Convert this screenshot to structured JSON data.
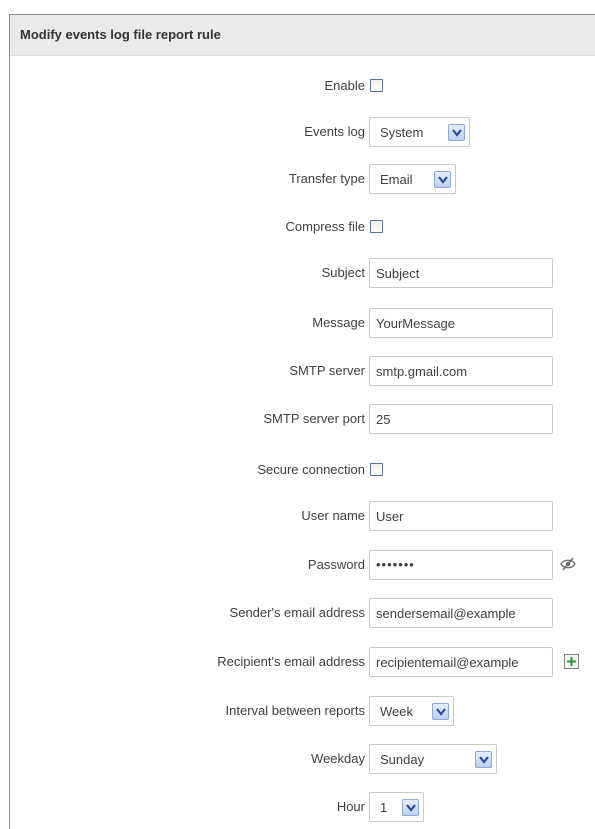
{
  "panel": {
    "title": "Modify events log file report rule"
  },
  "form": {
    "enable": {
      "label": "Enable",
      "checked": false
    },
    "events_log": {
      "label": "Events log",
      "value": "System"
    },
    "transfer_type": {
      "label": "Transfer type",
      "value": "Email"
    },
    "compress_file": {
      "label": "Compress file",
      "checked": false
    },
    "subject": {
      "label": "Subject",
      "value": "Subject"
    },
    "message": {
      "label": "Message",
      "value": "YourMessage"
    },
    "smtp_server": {
      "label": "SMTP server",
      "value": "smtp.gmail.com"
    },
    "smtp_port": {
      "label": "SMTP server port",
      "value": "25"
    },
    "secure_connection": {
      "label": "Secure connection",
      "checked": false
    },
    "user_name": {
      "label": "User name",
      "value": "User"
    },
    "password": {
      "label": "Password",
      "value": "•••••••"
    },
    "sender_email": {
      "label": "Sender's email address",
      "value": "sendersemail@example"
    },
    "recipient_email": {
      "label": "Recipient's email address",
      "value": "recipientemail@example"
    },
    "interval": {
      "label": "Interval between reports",
      "value": "Week"
    },
    "weekday": {
      "label": "Weekday",
      "value": "Sunday"
    },
    "hour": {
      "label": "Hour",
      "value": "1"
    }
  },
  "icons": {
    "dropdown": "chevron-down-icon",
    "password_toggle": "eye-slash-icon",
    "add_recipient": "plus-icon"
  },
  "colors": {
    "header_bg": "#eaeaea",
    "dropdown_button": "#bcd0f3",
    "add_icon": "#2e9a2e"
  }
}
